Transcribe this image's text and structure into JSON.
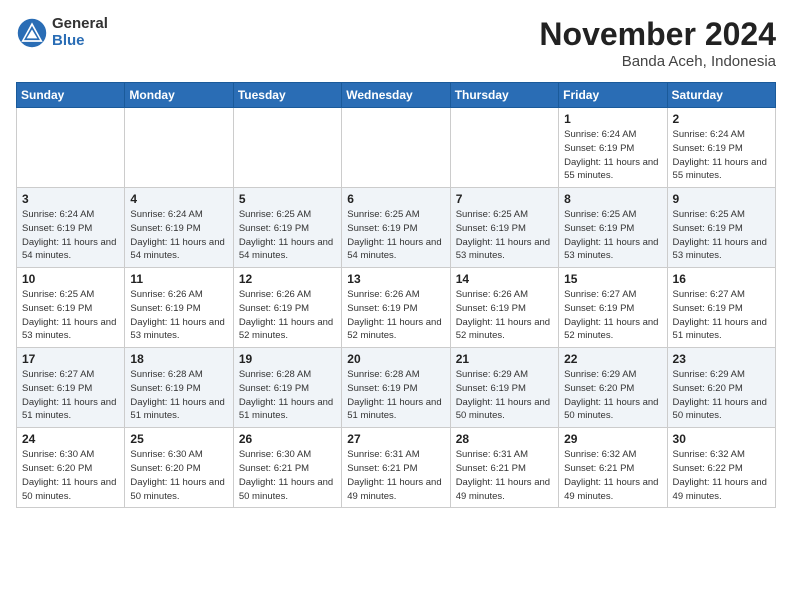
{
  "header": {
    "logo_general": "General",
    "logo_blue": "Blue",
    "title": "November 2024",
    "location": "Banda Aceh, Indonesia"
  },
  "days_of_week": [
    "Sunday",
    "Monday",
    "Tuesday",
    "Wednesday",
    "Thursday",
    "Friday",
    "Saturday"
  ],
  "weeks": [
    [
      {
        "day": "",
        "info": ""
      },
      {
        "day": "",
        "info": ""
      },
      {
        "day": "",
        "info": ""
      },
      {
        "day": "",
        "info": ""
      },
      {
        "day": "",
        "info": ""
      },
      {
        "day": "1",
        "info": "Sunrise: 6:24 AM\nSunset: 6:19 PM\nDaylight: 11 hours and 55 minutes."
      },
      {
        "day": "2",
        "info": "Sunrise: 6:24 AM\nSunset: 6:19 PM\nDaylight: 11 hours and 55 minutes."
      }
    ],
    [
      {
        "day": "3",
        "info": "Sunrise: 6:24 AM\nSunset: 6:19 PM\nDaylight: 11 hours and 54 minutes."
      },
      {
        "day": "4",
        "info": "Sunrise: 6:24 AM\nSunset: 6:19 PM\nDaylight: 11 hours and 54 minutes."
      },
      {
        "day": "5",
        "info": "Sunrise: 6:25 AM\nSunset: 6:19 PM\nDaylight: 11 hours and 54 minutes."
      },
      {
        "day": "6",
        "info": "Sunrise: 6:25 AM\nSunset: 6:19 PM\nDaylight: 11 hours and 54 minutes."
      },
      {
        "day": "7",
        "info": "Sunrise: 6:25 AM\nSunset: 6:19 PM\nDaylight: 11 hours and 53 minutes."
      },
      {
        "day": "8",
        "info": "Sunrise: 6:25 AM\nSunset: 6:19 PM\nDaylight: 11 hours and 53 minutes."
      },
      {
        "day": "9",
        "info": "Sunrise: 6:25 AM\nSunset: 6:19 PM\nDaylight: 11 hours and 53 minutes."
      }
    ],
    [
      {
        "day": "10",
        "info": "Sunrise: 6:25 AM\nSunset: 6:19 PM\nDaylight: 11 hours and 53 minutes."
      },
      {
        "day": "11",
        "info": "Sunrise: 6:26 AM\nSunset: 6:19 PM\nDaylight: 11 hours and 53 minutes."
      },
      {
        "day": "12",
        "info": "Sunrise: 6:26 AM\nSunset: 6:19 PM\nDaylight: 11 hours and 52 minutes."
      },
      {
        "day": "13",
        "info": "Sunrise: 6:26 AM\nSunset: 6:19 PM\nDaylight: 11 hours and 52 minutes."
      },
      {
        "day": "14",
        "info": "Sunrise: 6:26 AM\nSunset: 6:19 PM\nDaylight: 11 hours and 52 minutes."
      },
      {
        "day": "15",
        "info": "Sunrise: 6:27 AM\nSunset: 6:19 PM\nDaylight: 11 hours and 52 minutes."
      },
      {
        "day": "16",
        "info": "Sunrise: 6:27 AM\nSunset: 6:19 PM\nDaylight: 11 hours and 51 minutes."
      }
    ],
    [
      {
        "day": "17",
        "info": "Sunrise: 6:27 AM\nSunset: 6:19 PM\nDaylight: 11 hours and 51 minutes."
      },
      {
        "day": "18",
        "info": "Sunrise: 6:28 AM\nSunset: 6:19 PM\nDaylight: 11 hours and 51 minutes."
      },
      {
        "day": "19",
        "info": "Sunrise: 6:28 AM\nSunset: 6:19 PM\nDaylight: 11 hours and 51 minutes."
      },
      {
        "day": "20",
        "info": "Sunrise: 6:28 AM\nSunset: 6:19 PM\nDaylight: 11 hours and 51 minutes."
      },
      {
        "day": "21",
        "info": "Sunrise: 6:29 AM\nSunset: 6:19 PM\nDaylight: 11 hours and 50 minutes."
      },
      {
        "day": "22",
        "info": "Sunrise: 6:29 AM\nSunset: 6:20 PM\nDaylight: 11 hours and 50 minutes."
      },
      {
        "day": "23",
        "info": "Sunrise: 6:29 AM\nSunset: 6:20 PM\nDaylight: 11 hours and 50 minutes."
      }
    ],
    [
      {
        "day": "24",
        "info": "Sunrise: 6:30 AM\nSunset: 6:20 PM\nDaylight: 11 hours and 50 minutes."
      },
      {
        "day": "25",
        "info": "Sunrise: 6:30 AM\nSunset: 6:20 PM\nDaylight: 11 hours and 50 minutes."
      },
      {
        "day": "26",
        "info": "Sunrise: 6:30 AM\nSunset: 6:21 PM\nDaylight: 11 hours and 50 minutes."
      },
      {
        "day": "27",
        "info": "Sunrise: 6:31 AM\nSunset: 6:21 PM\nDaylight: 11 hours and 49 minutes."
      },
      {
        "day": "28",
        "info": "Sunrise: 6:31 AM\nSunset: 6:21 PM\nDaylight: 11 hours and 49 minutes."
      },
      {
        "day": "29",
        "info": "Sunrise: 6:32 AM\nSunset: 6:21 PM\nDaylight: 11 hours and 49 minutes."
      },
      {
        "day": "30",
        "info": "Sunrise: 6:32 AM\nSunset: 6:22 PM\nDaylight: 11 hours and 49 minutes."
      }
    ]
  ]
}
